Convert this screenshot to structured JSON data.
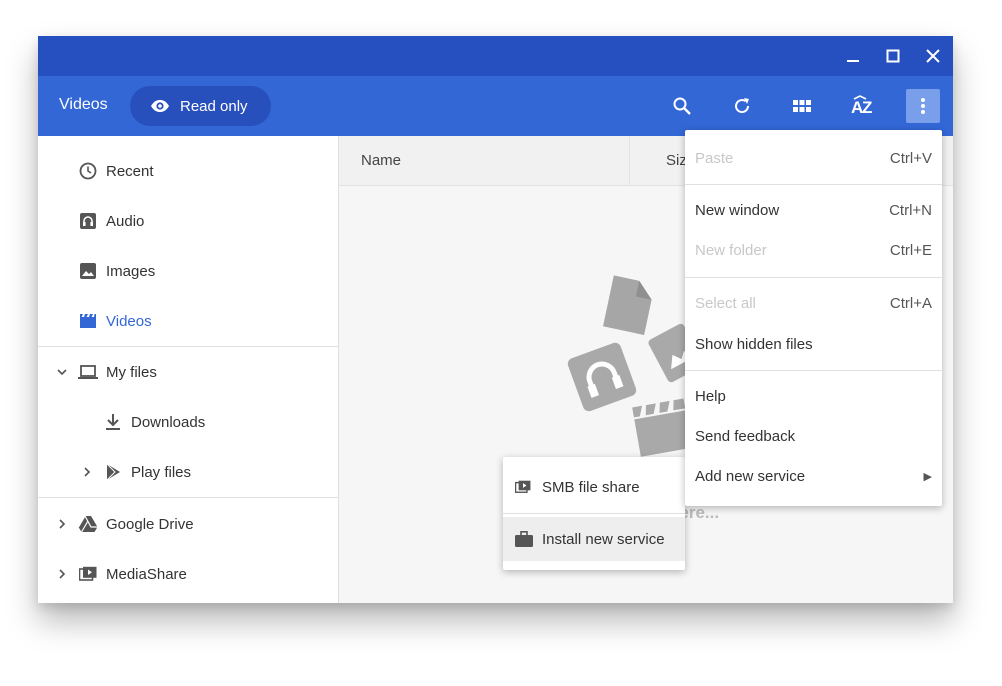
{
  "window": {
    "controls": {
      "minimize": "minimize-icon",
      "maximize": "maximize-icon",
      "close": "close-icon"
    }
  },
  "header": {
    "location_title": "Videos",
    "readonly_label": "Read only",
    "toolbar_icons": [
      "search-icon",
      "refresh-icon",
      "grid-view-icon",
      "sort-az-icon",
      "more-vert-icon"
    ]
  },
  "sidebar": {
    "recent": "Recent",
    "audio": "Audio",
    "images": "Images",
    "videos": "Videos",
    "my_files": "My files",
    "downloads": "Downloads",
    "play_files": "Play files",
    "google_drive": "Google Drive",
    "mediashare": "MediaShare"
  },
  "main": {
    "col_name": "Name",
    "col_size": "Size",
    "empty_message": "here..."
  },
  "menu": {
    "paste": {
      "label": "Paste",
      "key": "Ctrl+V"
    },
    "new_window": {
      "label": "New window",
      "key": "Ctrl+N"
    },
    "new_folder": {
      "label": "New folder",
      "key": "Ctrl+E"
    },
    "select_all": {
      "label": "Select all",
      "key": "Ctrl+A"
    },
    "show_hidden": {
      "label": "Show hidden files"
    },
    "help": {
      "label": "Help"
    },
    "send_feedback": {
      "label": "Send feedback"
    },
    "add_new_service": {
      "label": "Add new service",
      "arrow": "▶"
    }
  },
  "submenu": {
    "smb": "SMB file share",
    "install": "Install new service"
  },
  "colors": {
    "titlebar": "#2650c0",
    "header": "#3367d6",
    "accent": "#3367d6"
  }
}
